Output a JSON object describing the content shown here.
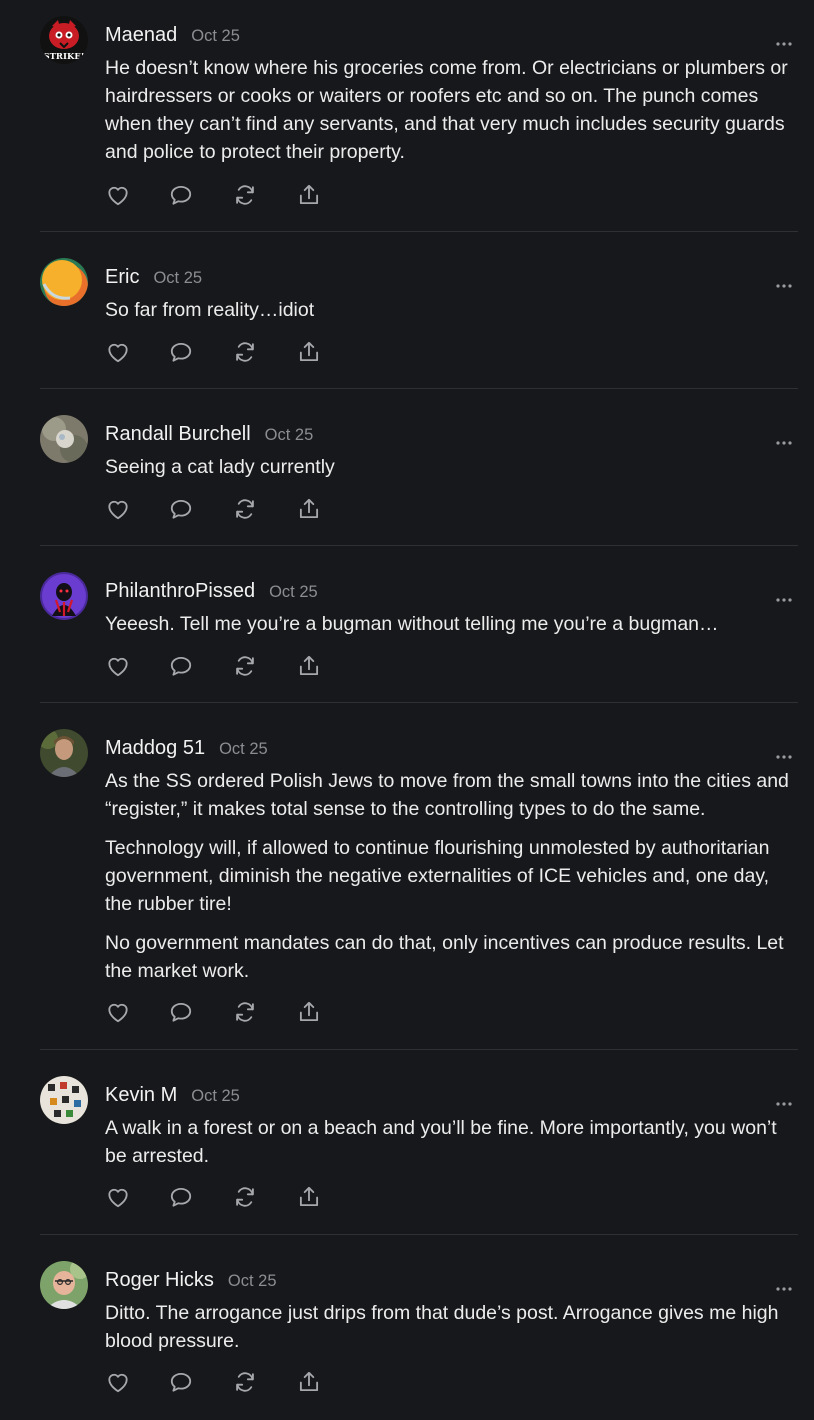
{
  "comments": [
    {
      "author": "Maenad",
      "date": "Oct 25",
      "avatar_text": "STRIKE!",
      "paragraphs": [
        "He doesn’t know where his groceries come from. Or electricians or plumbers or hairdressers or cooks or waiters or roofers etc and so on. The punch comes when they can’t find any servants, and that very much includes security guards and police to protect their property."
      ]
    },
    {
      "author": "Eric",
      "date": "Oct 25",
      "paragraphs": [
        "So far from reality…idiot"
      ]
    },
    {
      "author": "Randall Burchell",
      "date": "Oct 25",
      "paragraphs": [
        "Seeing a cat lady currently"
      ]
    },
    {
      "author": "PhilanthroPissed",
      "date": "Oct 25",
      "paragraphs": [
        "Yeeesh. Tell me you’re a bugman without telling me you’re a bugman…"
      ]
    },
    {
      "author": "Maddog 51",
      "date": "Oct 25",
      "paragraphs": [
        "As the SS ordered Polish Jews to move from the small towns into the cities and “register,” it makes total sense to the controlling types to do the same.",
        "Technology will, if allowed to continue flourishing unmolested by authoritarian government, diminish the negative externalities of ICE vehicles and, one day, the rubber tire!",
        "No government mandates can do that, only incentives can produce results. Let the market work."
      ]
    },
    {
      "author": "Kevin M",
      "date": "Oct 25",
      "paragraphs": [
        "A walk in a forest or on a beach and you’ll be fine. More importantly, you won’t be arrested."
      ]
    },
    {
      "author": "Roger Hicks",
      "date": "Oct 25",
      "paragraphs": [
        "Ditto. The arrogance just drips from that dude’s post. Arrogance gives me high blood pressure."
      ]
    }
  ],
  "action_icons": [
    "heart-icon",
    "reply-icon",
    "restack-icon",
    "share-icon"
  ],
  "more_icon": "ellipsis-icon",
  "colors": {
    "background": "#17181b",
    "text": "#ececec",
    "muted": "#8b8d92",
    "icon": "#a6a8ad",
    "divider": "#2e3034"
  }
}
